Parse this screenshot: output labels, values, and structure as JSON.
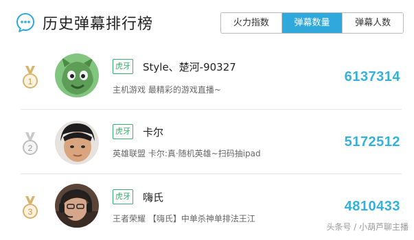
{
  "header": {
    "title": "历史弹幕排行榜",
    "tabs": [
      {
        "label": "火力指数",
        "active": false
      },
      {
        "label": "弹幕数量",
        "active": true
      },
      {
        "label": "弹幕人数",
        "active": false
      }
    ]
  },
  "rows": [
    {
      "rank": "1",
      "platform": "虎牙",
      "name": "Style、楚河-90327",
      "desc": "主机游戏 最精彩的游戏直播~",
      "count": "6137314"
    },
    {
      "rank": "2",
      "platform": "虎牙",
      "name": "卡尔",
      "desc": "英雄联盟 卡尔:真·随机英雄~扫码抽ipad",
      "count": "5172512"
    },
    {
      "rank": "3",
      "platform": "虎牙",
      "name": "嗨氏",
      "desc": "王者荣耀 【嗨氏】中单杀神单排法王江",
      "count": "4810433"
    }
  ],
  "watermark": "头条号 / 小葫芦聊主播",
  "colors": {
    "accent": "#2fa9dc",
    "count": "#35b0dc",
    "platform": "#35b069",
    "medal": "#d7b56d"
  }
}
